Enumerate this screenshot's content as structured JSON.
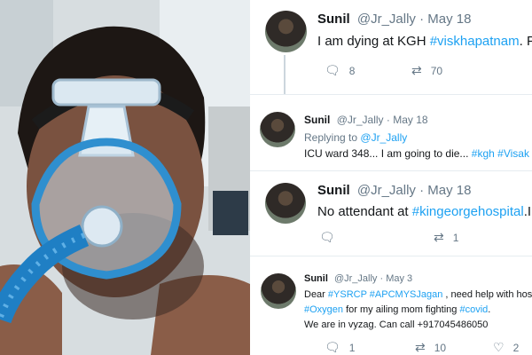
{
  "tweets": [
    {
      "name": "Sunil",
      "handle": "@Jr_Jally",
      "date": "May 18",
      "segments": [
        {
          "text": "I am dying at KGH ",
          "link": false
        },
        {
          "text": "#viskhapatnam",
          "link": true
        },
        {
          "text": ". Pl",
          "link": false
        }
      ],
      "replies": "8",
      "retweets": "70"
    },
    {
      "name": "Sunil",
      "handle": "@Jr_Jally",
      "date": "May 18",
      "replying_prefix": "Replying to",
      "replying_handle": "@Jr_Jally",
      "segments": [
        {
          "text": "ICU ward 348... I am going to die... ",
          "link": false
        },
        {
          "text": "#kgh",
          "link": true
        },
        {
          "text": " ",
          "link": false
        },
        {
          "text": "#Visak",
          "link": true
        }
      ]
    },
    {
      "name": "Sunil",
      "handle": "@Jr_Jally",
      "date": "May 18",
      "segments": [
        {
          "text": "No attendant at ",
          "link": false
        },
        {
          "text": "#kingeorgehospital",
          "link": true
        },
        {
          "text": ".I a",
          "link": false
        }
      ],
      "replies": "",
      "retweets": "1"
    },
    {
      "name": "Sunil",
      "handle": "@Jr_Jally",
      "date": "May 3",
      "line1": [
        {
          "text": "Dear ",
          "link": false
        },
        {
          "text": "#YSRCP",
          "link": true
        },
        {
          "text": " ",
          "link": false
        },
        {
          "text": "#APCMYSJagan",
          "link": true
        },
        {
          "text": " , need help with hos",
          "link": false
        }
      ],
      "line2": [
        {
          "text": "#Oxygen",
          "link": true
        },
        {
          "text": " for my ailing mom fighting ",
          "link": false
        },
        {
          "text": "#covid",
          "link": true
        },
        {
          "text": ".",
          "link": false
        }
      ],
      "line3": "We are in vyzag. Can call +917045486050",
      "replies": "1",
      "retweets": "10",
      "likes": "2"
    }
  ],
  "icons": {
    "reply": "reply-icon",
    "retweet": "retweet-icon",
    "like": "heart-icon"
  }
}
